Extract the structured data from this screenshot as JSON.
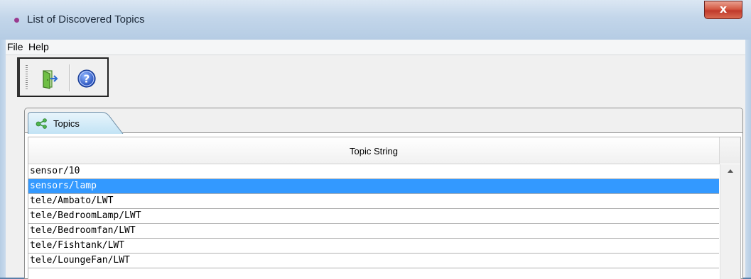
{
  "window": {
    "title": "List of Discovered Topics",
    "close_glyph": "x"
  },
  "menu": {
    "items": [
      "File",
      "Help"
    ]
  },
  "toolbar": {
    "icons": [
      "exit-icon",
      "help-icon"
    ]
  },
  "tabs": [
    {
      "label": "Topics",
      "icon": "share-icon"
    }
  ],
  "table": {
    "header": "Topic String",
    "selected_index": 1,
    "selected_color": "#3399ff",
    "rows": [
      "sensor/10",
      "sensors/lamp",
      "tele/Ambato/LWT",
      "tele/BedroomLamp/LWT",
      "tele/Bedroomfan/LWT",
      "tele/Fishtank/LWT",
      "tele/LoungeFan/LWT"
    ]
  }
}
